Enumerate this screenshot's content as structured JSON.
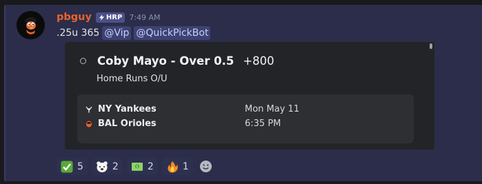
{
  "message": {
    "username": "pbguy",
    "role_tag": "HRP",
    "timestamp": "7:49 AM",
    "text": ".25u 365",
    "mentions": [
      "@Vip",
      "@QuickPickBot"
    ]
  },
  "embed": {
    "pick_title": "Coby Mayo - Over 0.5",
    "odds": "+800",
    "market": "Home Runs O/U",
    "game": {
      "home_team": "NY Yankees",
      "away_team": "BAL Orioles",
      "date": "Mon May 11",
      "time": "6:35 PM"
    }
  },
  "reactions": [
    {
      "emoji": "check-mark-icon",
      "count": "5"
    },
    {
      "emoji": "polar-bear-icon",
      "count": "2"
    },
    {
      "emoji": "money-bill-icon",
      "count": "2"
    },
    {
      "emoji": "fire-icon",
      "count": "1"
    }
  ],
  "colors": {
    "username": "#e8622c",
    "message_bg": "#2b2d4a",
    "embed_bg": "#232427",
    "mention_bg": "#3c4372"
  }
}
